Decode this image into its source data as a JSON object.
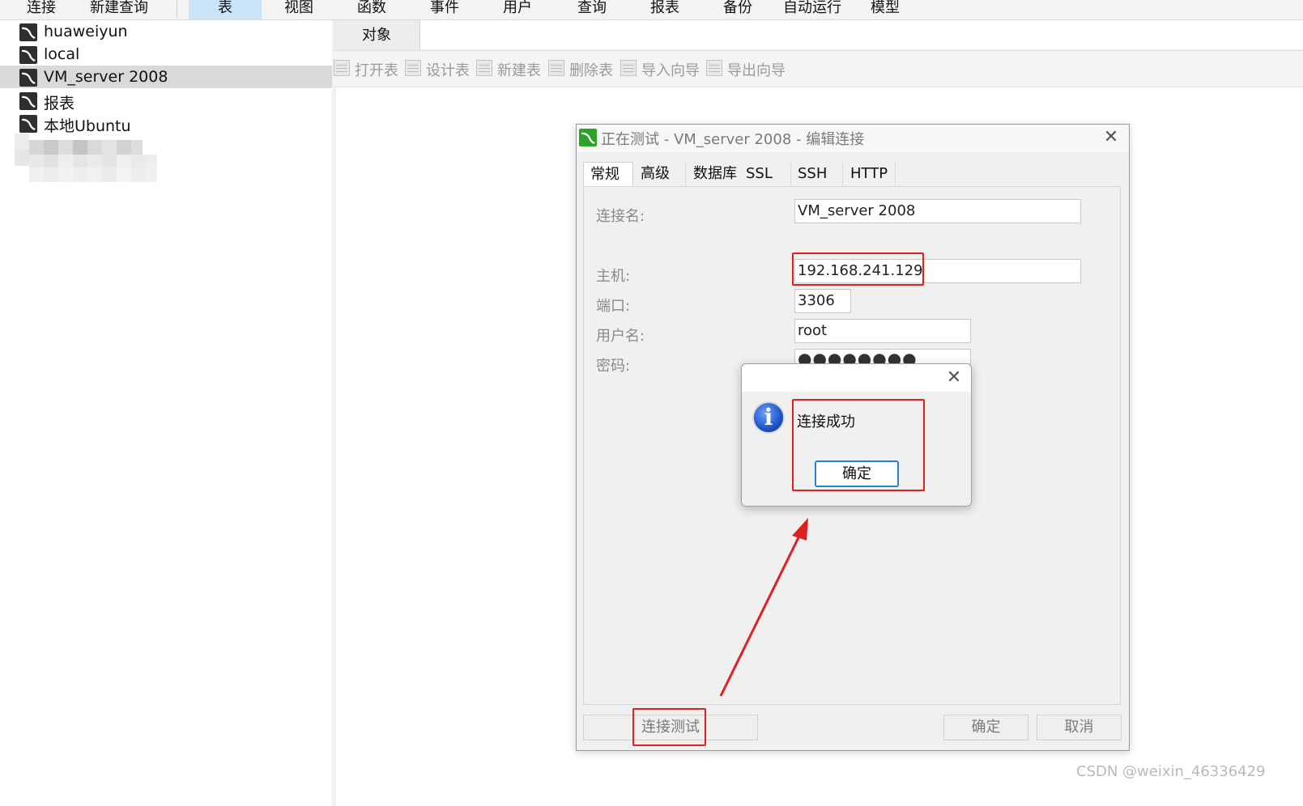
{
  "menu": {
    "items": [
      "连接",
      "新建查询",
      "表",
      "视图",
      "函数",
      "事件",
      "用户",
      "查询",
      "报表",
      "备份",
      "自动运行",
      "模型"
    ],
    "active_index": 2
  },
  "sidebar": {
    "items": [
      {
        "label": "huaweiyun"
      },
      {
        "label": "local"
      },
      {
        "label": "VM_server 2008"
      },
      {
        "label": "报表"
      },
      {
        "label": "本地Ubuntu"
      }
    ],
    "selected_index": 2,
    "item_icon": "mysql-connection-icon"
  },
  "main": {
    "tab_label": "对象",
    "toolbar": [
      "打开表",
      "设计表",
      "新建表",
      "删除表",
      "导入向导",
      "导出向导"
    ]
  },
  "dialog": {
    "title": "正在测试 - VM_server 2008 - 编辑连接",
    "tabs": [
      "常规",
      "高级",
      "数据库",
      "SSL",
      "SSH",
      "HTTP"
    ],
    "active_tab": 0,
    "fields": {
      "connection_name_label": "连接名:",
      "connection_name_value": "VM_server 2008",
      "host_label": "主机:",
      "host_value": "192.168.241.129",
      "port_label": "端口:",
      "port_value": "3306",
      "username_label": "用户名:",
      "username_value": "root",
      "password_label": "密码:",
      "password_value": "●●●●●●●●"
    },
    "buttons": {
      "test": "连接测试",
      "ok": "确定",
      "cancel": "取消"
    }
  },
  "message_box": {
    "text": "连接成功",
    "ok_label": "确定",
    "icon": "info-icon"
  },
  "annotation_color": "#e02020",
  "watermark": "CSDN @weixin_46336429"
}
